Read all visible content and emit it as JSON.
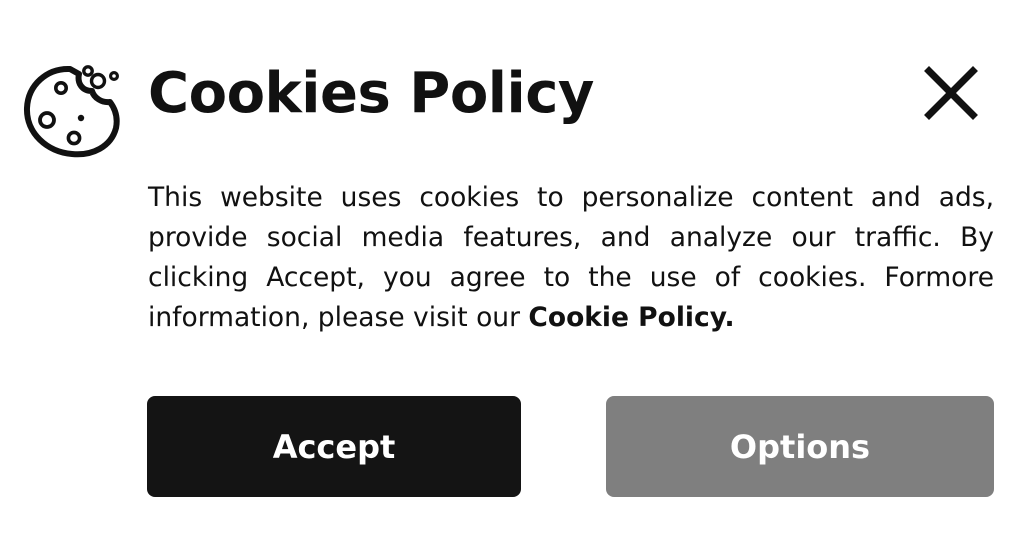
{
  "dialog": {
    "title": "Cookies Policy",
    "icon": "cookie-icon",
    "close_icon": "close-icon",
    "message": "This website uses cookies to personalize content and ads, provide social media features, and analyze our traffic. By clicking Accept, you agree to the use of cookies. Formore information, please visit our ",
    "policy_link": "Cookie Policy."
  },
  "buttons": {
    "accept_label": "Accept",
    "options_label": "Options"
  },
  "colors": {
    "text": "#111111",
    "accept_bg": "#141414",
    "options_bg": "#7f7f7f",
    "background": "#ffffff"
  }
}
